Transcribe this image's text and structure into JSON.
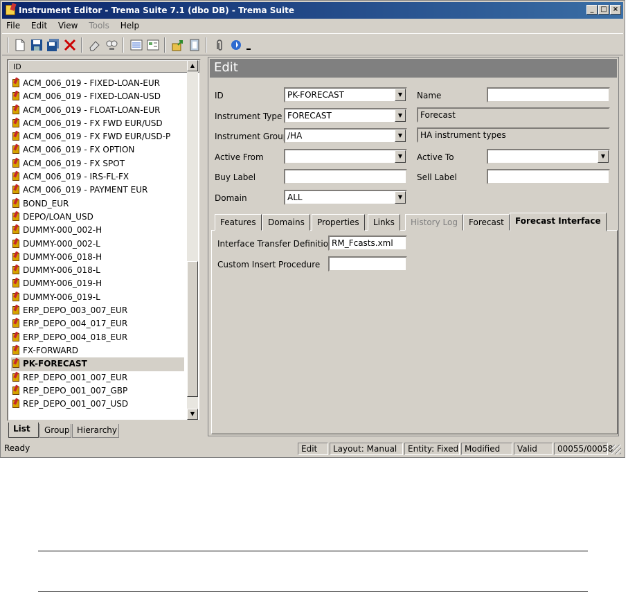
{
  "window": {
    "title": "Instrument Editor - Trema Suite 7.1 (dbo DB)  - Trema Suite",
    "min_label": "_",
    "max_label": "□",
    "close_label": "×"
  },
  "menu": [
    {
      "label": "File",
      "enabled": true
    },
    {
      "label": "Edit",
      "enabled": true
    },
    {
      "label": "View",
      "enabled": true
    },
    {
      "label": "Tools",
      "enabled": false
    },
    {
      "label": "Help",
      "enabled": true
    }
  ],
  "list_panel": {
    "header": "ID",
    "items": [
      "ACM_006_019 - FIXED-LOAN-EUR",
      "ACM_006_019 - FIXED-LOAN-USD",
      "ACM_006_019 - FLOAT-LOAN-EUR",
      "ACM_006_019 - FX FWD EUR/USD",
      "ACM_006_019 - FX FWD EUR/USD-P",
      "ACM_006_019 - FX OPTION",
      "ACM_006_019 - FX SPOT",
      "ACM_006_019 - IRS-FL-FX",
      "ACM_006_019 - PAYMENT EUR",
      "BOND_EUR",
      "DEPO/LOAN_USD",
      "DUMMY-000_002-H",
      "DUMMY-000_002-L",
      "DUMMY-006_018-H",
      "DUMMY-006_018-L",
      "DUMMY-006_019-H",
      "DUMMY-006_019-L",
      "ERP_DEPO_003_007_EUR",
      "ERP_DEPO_004_017_EUR",
      "ERP_DEPO_004_018_EUR",
      "FX-FORWARD",
      "PK-FORECAST",
      "REP_DEPO_001_007_EUR",
      "REP_DEPO_001_007_GBP",
      "REP_DEPO_001_007_USD"
    ],
    "selected": "PK-FORECAST",
    "tabs": [
      "List",
      "Group",
      "Hierarchy"
    ],
    "active_tab": "List"
  },
  "edit": {
    "title": "Edit",
    "id_label": "ID",
    "id_value": "PK-FORECAST",
    "name_label": "Name",
    "name_value": "",
    "type_label": "Instrument Type",
    "type_value": "FORECAST",
    "type_desc": "Forecast",
    "group_label": "Instrument Group",
    "group_value": "/HA",
    "group_desc": "HA instrument types",
    "active_from_label": "Active From",
    "active_from_value": "",
    "active_to_label": "Active To",
    "active_to_value": "",
    "buy_label": "Buy Label",
    "buy_value": "",
    "sell_label": "Sell Label",
    "sell_value": "",
    "domain_label": "Domain",
    "domain_value": "ALL",
    "tabs": [
      {
        "label": "Features",
        "enabled": true
      },
      {
        "label": "Domains",
        "enabled": true
      },
      {
        "label": "Properties",
        "enabled": true
      },
      {
        "label": "Links",
        "enabled": true
      },
      {
        "label": "History Log",
        "enabled": false
      },
      {
        "label": "Forecast",
        "enabled": true
      },
      {
        "label": "Forecast Interface",
        "enabled": true
      }
    ],
    "active_tab": "Forecast Interface",
    "itd_label": "Interface Transfer Definition",
    "itd_value": "RM_Fcasts.xml",
    "cip_label": "Custom Insert Procedure",
    "cip_value": ""
  },
  "status": {
    "ready": "Ready",
    "mode": "Edit",
    "layout": "Layout: Manual",
    "entity": "Entity: Fixed",
    "modified": "Modified",
    "valid": "Valid",
    "record": "00055/00058"
  },
  "colors": {
    "title_start": "#0a246a",
    "title_end": "#3a6ea5",
    "face": "#d4d0c8",
    "header_gray": "#808080"
  }
}
